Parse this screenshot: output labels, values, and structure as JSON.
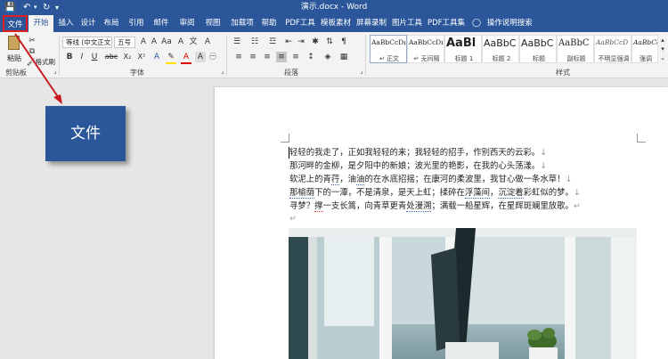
{
  "window": {
    "title": "演示.docx - Word",
    "save_icon": "save-icon",
    "undo_icon": "undo-icon",
    "redo_icon": "redo-icon",
    "qat_icon": "customize-qat-icon"
  },
  "tabs": [
    {
      "label": "文件"
    },
    {
      "label": "开始"
    },
    {
      "label": "插入"
    },
    {
      "label": "设计"
    },
    {
      "label": "布局"
    },
    {
      "label": "引用"
    },
    {
      "label": "邮件"
    },
    {
      "label": "审阅"
    },
    {
      "label": "视图"
    },
    {
      "label": "加载项"
    },
    {
      "label": "帮助"
    },
    {
      "label": "PDF工具"
    },
    {
      "label": "模板素材"
    },
    {
      "label": "屏幕录制"
    },
    {
      "label": "图片工具"
    },
    {
      "label": "PDF工具集"
    }
  ],
  "tell_me": "操作说明搜索",
  "ribbon": {
    "clipboard": {
      "label": "剪贴板",
      "paste": "粘贴",
      "format_painter": "格式刷"
    },
    "font": {
      "label": "字体",
      "family": "等线 (中文正文)",
      "size": "五号",
      "bold": "B",
      "italic": "I",
      "underline": "U",
      "strike": "abc",
      "sub": "X₂",
      "sup": "X²"
    },
    "paragraph": {
      "label": "段落"
    },
    "styles": {
      "label": "样式",
      "items": [
        {
          "preview": "AaBbCcDı",
          "name": "↵ 正文"
        },
        {
          "preview": "AaBbCcDı",
          "name": "↵ 无间隔"
        },
        {
          "preview": "AaBl",
          "name": "标题 1"
        },
        {
          "preview": "AaBbC",
          "name": "标题 2"
        },
        {
          "preview": "AaBbC",
          "name": "标题"
        },
        {
          "preview": "AaBbC",
          "name": "副标题"
        },
        {
          "preview": "AaBbCcD",
          "name": "不明显强调"
        },
        {
          "preview": "AaBbCcD",
          "name": "强调"
        }
      ]
    }
  },
  "callout": {
    "label": "文件"
  },
  "document": {
    "lines": [
      [
        "轻轻的我走了，正如我轻轻的来；我轻轻的招手，作别西天的云彩。",
        "↓"
      ],
      [
        "那河畔的金柳，是夕阳中的新娘；波光里的艳影，在我的心头荡漾。",
        "↓"
      ],
      [
        "软泥上的青",
        "荇",
        "，油",
        "油",
        "的在水底招摇；在康河的柔波里，我甘心做一条水草！",
        "↓"
      ],
      [
        "那榆荫",
        "下的一潭，不是清泉，是天上虹；揉碎在",
        "浮藻间",
        "，",
        "沉淀着",
        "彩虹似的梦。",
        "↓"
      ],
      [
        "寻梦？",
        "撑",
        "一支长篙，向青草更青",
        "处漫溯",
        "；满载一船星辉，在星辉斑斓里放歌。",
        "↵"
      ],
      [
        "↵"
      ]
    ]
  },
  "colors": {
    "brand": "#2b579a",
    "highlight": "#e02020"
  }
}
